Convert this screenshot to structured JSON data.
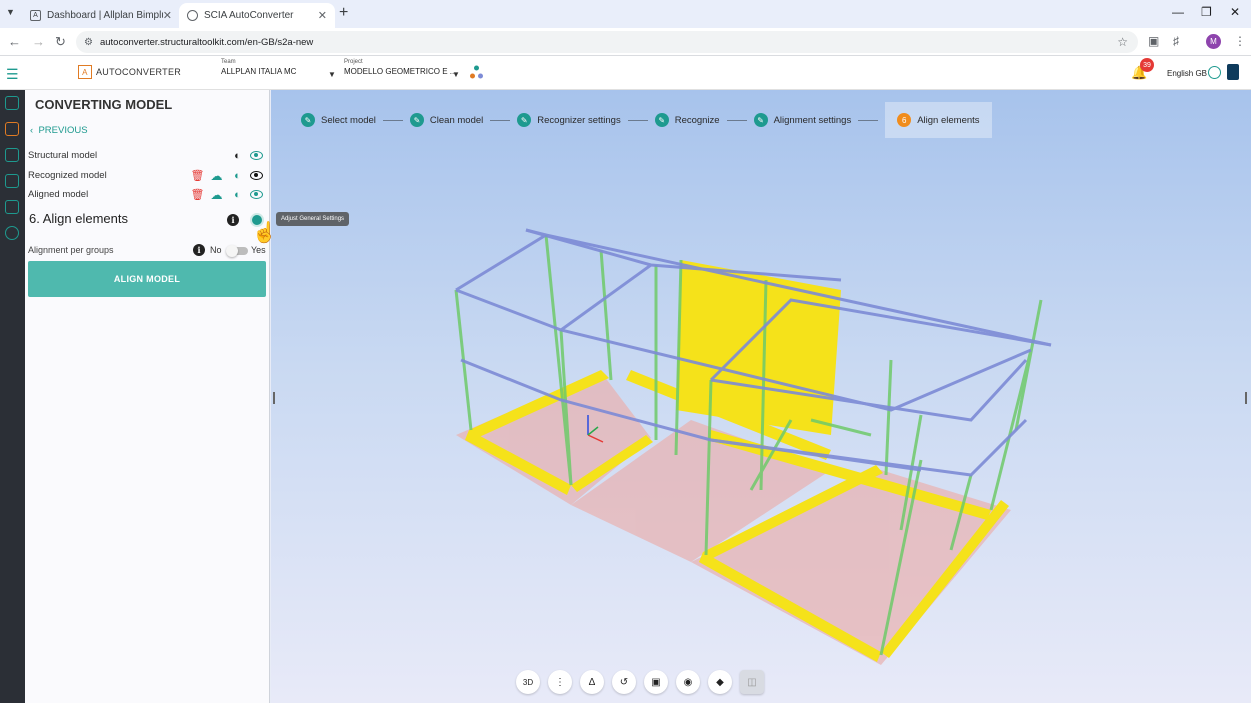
{
  "browser": {
    "tabs": [
      {
        "label": "Dashboard | Allplan Bimplus",
        "active": false
      },
      {
        "label": "SCIA AutoConverter",
        "active": true
      }
    ],
    "url": "autoconverter.structuraltoolkit.com/en-GB/s2a-new",
    "profile_initial": "M"
  },
  "app": {
    "logo_text": "AUTOCONVERTER",
    "logo_mark": "A",
    "team_caption": "Team",
    "team_value": "ALLPLAN ITALIA MC",
    "project_caption": "Project",
    "project_value": "MODELLO GEOMETRICO E ...",
    "notification_count": "39",
    "language": "English GB"
  },
  "panel": {
    "title": "CONVERTING MODEL",
    "previous_label": "PREVIOUS",
    "models": [
      {
        "label": "Structural model"
      },
      {
        "label": "Recognized model"
      },
      {
        "label": "Aligned model"
      }
    ],
    "step_title": "6.  Align elements",
    "tooltip": "Adjust General Settings",
    "alignment_label": "Alignment per groups",
    "toggle_no": "No",
    "toggle_yes": "Yes",
    "toggle_value": false,
    "align_button": "ALIGN MODEL"
  },
  "stepper": [
    {
      "label": "Select model",
      "state": "done"
    },
    {
      "label": "Clean model",
      "state": "done"
    },
    {
      "label": "Recognizer settings",
      "state": "done"
    },
    {
      "label": "Recognize",
      "state": "done"
    },
    {
      "label": "Alignment settings",
      "state": "done"
    },
    {
      "label": "Align elements",
      "state": "current",
      "number": "6"
    }
  ],
  "toolbar": {
    "view_mode": "3D"
  },
  "colors": {
    "accent": "#1e9a8f",
    "orange": "#f08c1c",
    "slab": "#f5e21a",
    "beam": "#7d8bd6",
    "column": "#8fd48a",
    "foundation": "#e8b4b4"
  }
}
